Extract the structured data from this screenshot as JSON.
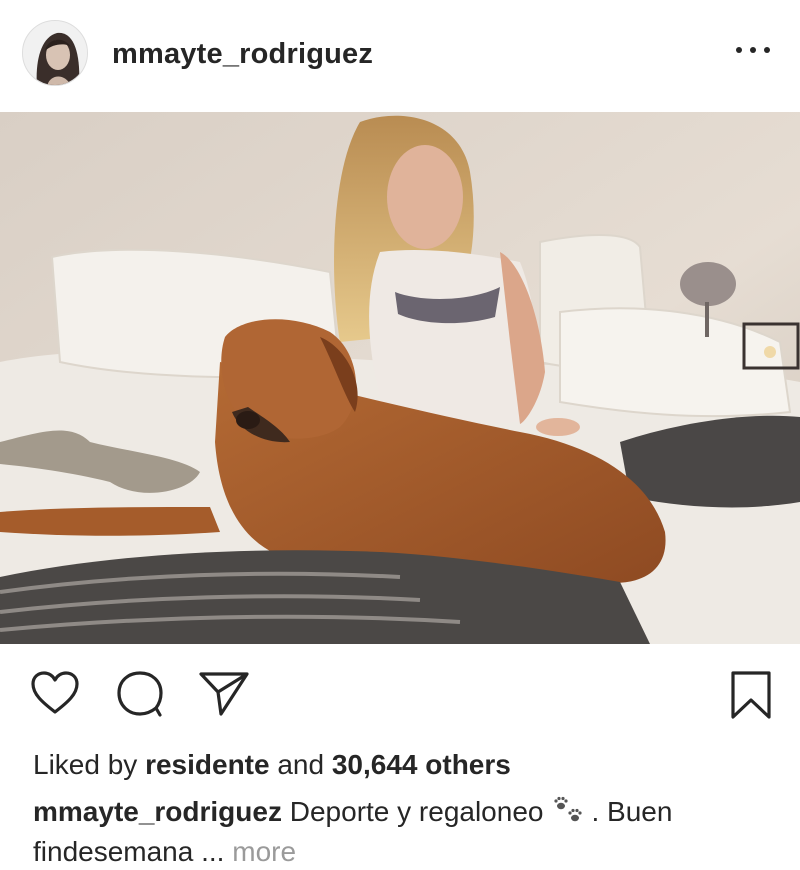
{
  "post": {
    "username": "mmayte_rodriguez",
    "more_menu_icon": "more-horizontal-icon",
    "photo_description_icon": "post-photo"
  },
  "actions": {
    "like_icon": "heart-icon",
    "comment_icon": "comment-icon",
    "share_icon": "share-icon",
    "save_icon": "bookmark-icon"
  },
  "likes": {
    "prefix": "Liked by",
    "user": "residente",
    "conjunction": "and",
    "count": "30,644 others"
  },
  "caption": {
    "username": "mmayte_rodriguez",
    "text_before_emoji": "Deporte y regaloneo",
    "emoji_icon": "paw-prints-icon",
    "text_after_emoji": ". Buen findesemana",
    "ellipsis": "...",
    "more_label": "more"
  }
}
